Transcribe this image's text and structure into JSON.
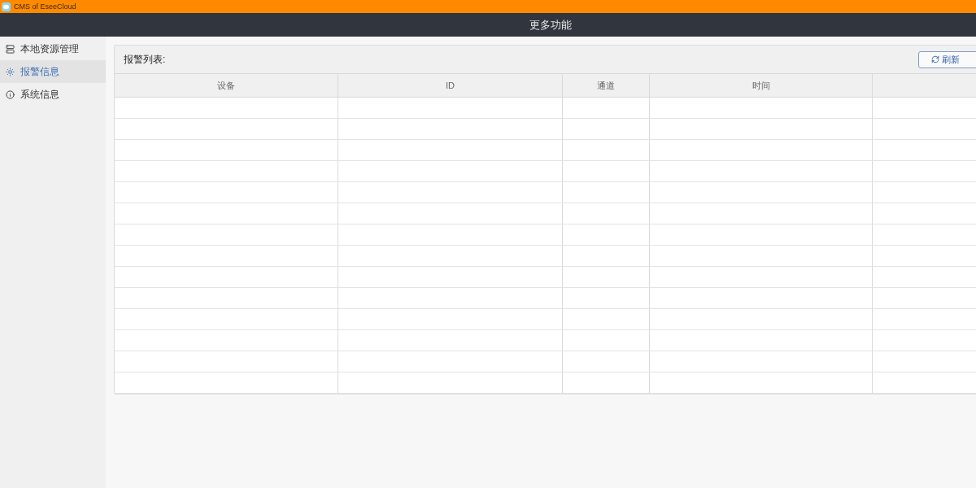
{
  "window": {
    "title": "CMS of EseeCloud"
  },
  "header": {
    "title": "更多功能"
  },
  "sidebar": {
    "items": [
      {
        "label": "本地资源管理",
        "selected": false
      },
      {
        "label": "报警信息",
        "selected": true
      },
      {
        "label": "系统信息",
        "selected": false
      }
    ]
  },
  "alarm_panel": {
    "title": "报警列表:",
    "refresh_button": "刷新",
    "table": {
      "columns": [
        "设备",
        "ID",
        "通道",
        "时间"
      ]
    }
  }
}
